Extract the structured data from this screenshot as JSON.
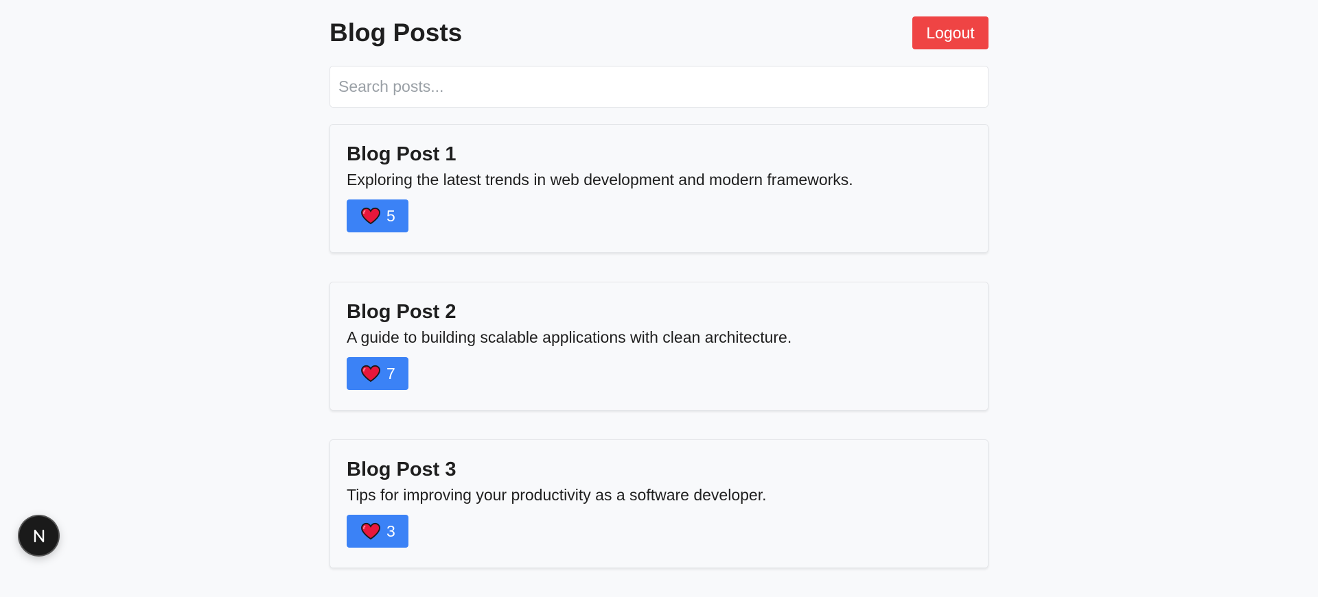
{
  "header": {
    "title": "Blog Posts",
    "logout_label": "Logout"
  },
  "search": {
    "placeholder": "Search posts...",
    "value": ""
  },
  "posts": [
    {
      "title": "Blog Post 1",
      "excerpt": "Exploring the latest trends in web development and modern frameworks.",
      "likes": "5",
      "like_icon": "heart-icon"
    },
    {
      "title": "Blog Post 2",
      "excerpt": "A guide to building scalable applications with clean architecture.",
      "likes": "7",
      "like_icon": "heart-icon"
    },
    {
      "title": "Blog Post 3",
      "excerpt": "Tips for improving your productivity as a software developer.",
      "likes": "3",
      "like_icon": "heart-icon"
    }
  ],
  "dev_badge": {
    "icon": "nextjs-logo-icon"
  },
  "colors": {
    "background": "#f8f9fb",
    "logout_button": "#ef4444",
    "like_button": "#3b82f6",
    "heart": "#e8173b",
    "text": "#1f1f1f"
  }
}
